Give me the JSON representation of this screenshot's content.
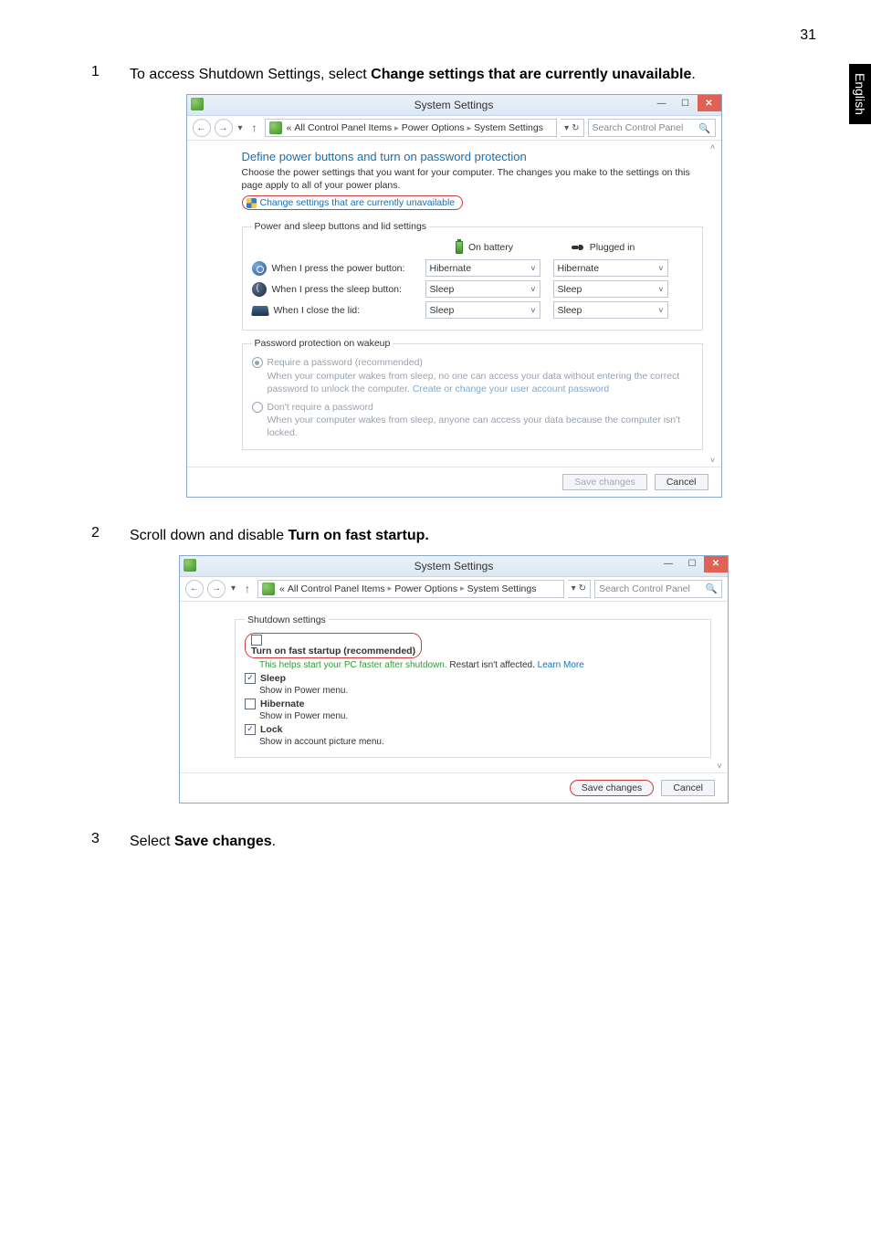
{
  "page_number": "31",
  "lang_tab": "English",
  "steps": {
    "s1_num": "1",
    "s1_pre": "To access Shutdown Settings, select ",
    "s1_bold": "Change settings that are currently unavailable",
    "s1_post": ".",
    "s2_num": "2",
    "s2_pre": "Scroll down and disable ",
    "s2_bold": "Turn on fast startup.",
    "s3_num": "3",
    "s3_pre": "Select ",
    "s3_bold": "Save changes",
    "s3_post": "."
  },
  "win1": {
    "title": "System Settings",
    "breadcrumb": {
      "pre": "«",
      "p1": "All Control Panel Items",
      "p2": "Power Options",
      "p3": "System Settings"
    },
    "search_placeholder": "Search Control Panel",
    "heading": "Define power buttons and turn on password protection",
    "descr": "Choose the power settings that you want for your computer. The changes you make to the settings on this page apply to all of your power plans.",
    "change_link": "Change settings that are currently unavailable",
    "group1_legend": "Power and sleep buttons and lid settings",
    "col_battery": "On battery",
    "col_plugged": "Plugged in",
    "row_power_label": "When I press the power button:",
    "row_power_batt": "Hibernate",
    "row_power_plug": "Hibernate",
    "row_sleep_label": "When I press the sleep button:",
    "row_sleep_batt": "Sleep",
    "row_sleep_plug": "Sleep",
    "row_lid_label": "When I close the lid:",
    "row_lid_batt": "Sleep",
    "row_lid_plug": "Sleep",
    "group2_legend": "Password protection on wakeup",
    "radio1_title": "Require a password (recommended)",
    "radio1_text": "When your computer wakes from sleep, no one can access your data without entering the correct password to unlock the computer. ",
    "radio1_link": "Create or change your user account password",
    "radio2_title": "Don't require a password",
    "radio2_text": "When your computer wakes from sleep, anyone can access your data because the computer isn't locked.",
    "btn_save": "Save changes",
    "btn_cancel": "Cancel"
  },
  "win2": {
    "title": "System Settings",
    "breadcrumb": {
      "pre": "«",
      "p1": "All Control Panel Items",
      "p2": "Power Options",
      "p3": "System Settings"
    },
    "search_placeholder": "Search Control Panel",
    "group_legend": "Shutdown settings",
    "opt1_label": "Turn on fast startup (recommended)",
    "opt1_sub_green": "This helps start your PC faster after shutdown.",
    "opt1_sub_rest": " Restart isn't affected. ",
    "opt1_sub_link": "Learn More",
    "opt2_label": "Sleep",
    "opt2_sub": "Show in Power menu.",
    "opt3_label": "Hibernate",
    "opt3_sub": "Show in Power menu.",
    "opt4_label": "Lock",
    "opt4_sub": "Show in account picture menu.",
    "btn_save": "Save changes",
    "btn_cancel": "Cancel"
  }
}
